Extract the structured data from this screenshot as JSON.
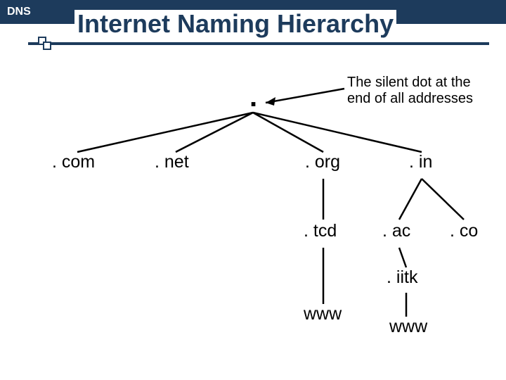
{
  "header": {
    "label": "DNS"
  },
  "title": "Internet Naming Hierarchy",
  "annotation": {
    "line1": "The silent dot at the",
    "line2": "end of all addresses"
  },
  "nodes": {
    "root": ".",
    "com": ". com",
    "net": ". net",
    "org": ". org",
    "in": ". in",
    "tcd": ". tcd",
    "ac": ". ac",
    "co": ". co",
    "iitk": ". iitk",
    "www1": "www",
    "www2": "www"
  }
}
